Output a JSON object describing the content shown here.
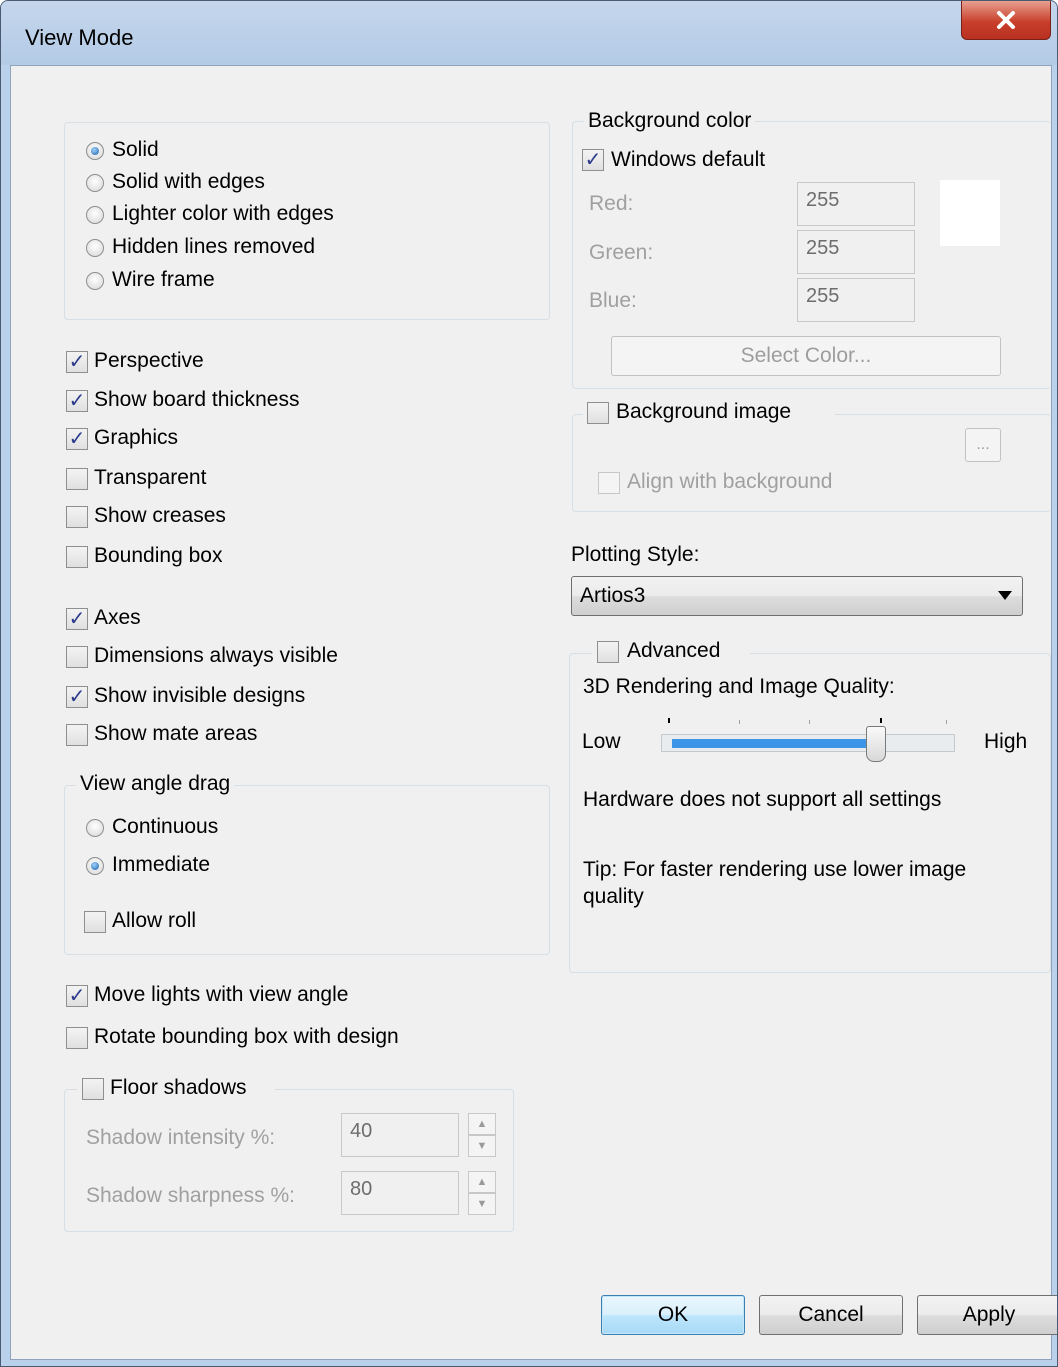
{
  "window": {
    "title": "View Mode",
    "close_label": "x"
  },
  "render_mode": {
    "options": [
      {
        "label": "Solid",
        "selected": true
      },
      {
        "label": "Solid with edges",
        "selected": false
      },
      {
        "label": "Lighter color with edges",
        "selected": false
      },
      {
        "label": "Hidden lines removed",
        "selected": false
      },
      {
        "label": "Wire frame",
        "selected": false
      }
    ]
  },
  "options": {
    "perspective": {
      "label": "Perspective",
      "checked": true
    },
    "show_board_thickness": {
      "label": "Show board thickness",
      "checked": true
    },
    "graphics": {
      "label": "Graphics",
      "checked": true
    },
    "transparent": {
      "label": "Transparent",
      "checked": false
    },
    "show_creases": {
      "label": "Show creases",
      "checked": false
    },
    "bounding_box": {
      "label": "Bounding box",
      "checked": false
    },
    "axes": {
      "label": "Axes",
      "checked": true
    },
    "dimensions_always_visible": {
      "label": "Dimensions always visible",
      "checked": false
    },
    "show_invisible_designs": {
      "label": "Show invisible designs",
      "checked": true
    },
    "show_mate_areas": {
      "label": "Show mate areas",
      "checked": false
    },
    "move_lights": {
      "label": "Move lights with view angle",
      "checked": true
    },
    "rotate_bounding_box": {
      "label": "Rotate bounding box with design",
      "checked": false
    }
  },
  "view_angle_drag": {
    "title": "View angle drag",
    "continuous": {
      "label": "Continuous",
      "selected": false
    },
    "immediate": {
      "label": "Immediate",
      "selected": true
    },
    "allow_roll": {
      "label": "Allow roll",
      "checked": false
    }
  },
  "floor_shadows": {
    "label": "Floor shadows",
    "checked": false,
    "intensity_label": "Shadow intensity %:",
    "intensity_value": "40",
    "sharpness_label": "Shadow sharpness %:",
    "sharpness_value": "80",
    "spin_up": "▲",
    "spin_down": "▼"
  },
  "background_color": {
    "title": "Background color",
    "windows_default": {
      "label": "Windows default",
      "checked": true
    },
    "red_label": "Red:",
    "red_value": "255",
    "green_label": "Green:",
    "green_value": "255",
    "blue_label": "Blue:",
    "blue_value": "255",
    "swatch_color": "#ffffff",
    "select_color_label": "Select Color..."
  },
  "background_image": {
    "label": "Background image",
    "checked": false,
    "browse_label": "...",
    "align": {
      "label": "Align with background",
      "checked": false
    }
  },
  "plotting_style": {
    "label": "Plotting Style:",
    "value": "Artios3"
  },
  "advanced": {
    "label": "Advanced",
    "checked": false,
    "quality_label": "3D Rendering and Image Quality:",
    "low_label": "Low",
    "high_label": "High",
    "quality_level": 0.75,
    "hardware_note": "Hardware does not support all settings",
    "tip": "Tip: For faster rendering use lower image quality"
  },
  "buttons": {
    "ok": "OK",
    "cancel": "Cancel",
    "apply": "Apply"
  },
  "colors": {
    "slider_fill": "#3d95e8",
    "title_bg": "#b9d1ea",
    "close_bg": "#c8402c"
  }
}
